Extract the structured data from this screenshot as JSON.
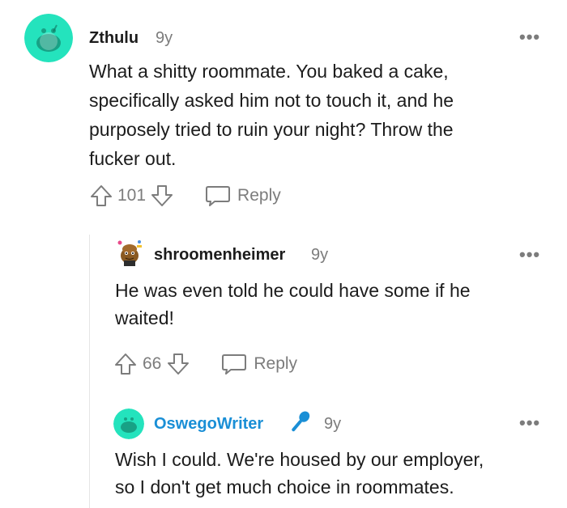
{
  "comments": [
    {
      "username": "Zthulu",
      "age": "9y",
      "more": "•••",
      "body_lines": [
        "What a shitty roommate. You baked a cake,",
        "specifically asked him not to touch it, and he",
        "purposely tried to ruin your night? Throw the",
        "fucker out."
      ],
      "score": "101",
      "reply_label": "Reply"
    },
    {
      "username": "shroomenheimer",
      "age": "9y",
      "more": "•••",
      "body_lines": [
        "He was even told he could have some if he",
        "waited!"
      ],
      "score": "66",
      "reply_label": "Reply"
    },
    {
      "username": "OswegoWriter",
      "age": "9y",
      "more": "•••",
      "body_lines": [
        "Wish I could. We're housed by our employer,",
        "so I don't get much choice in roommates."
      ],
      "flair_icon": "microphone-icon"
    }
  ],
  "colors": {
    "avatar_teal": "#24e3bd",
    "username_blue": "#1a8fd6",
    "mic_blue": "#1a8fd6",
    "meta_gray": "#7c7c7c"
  }
}
